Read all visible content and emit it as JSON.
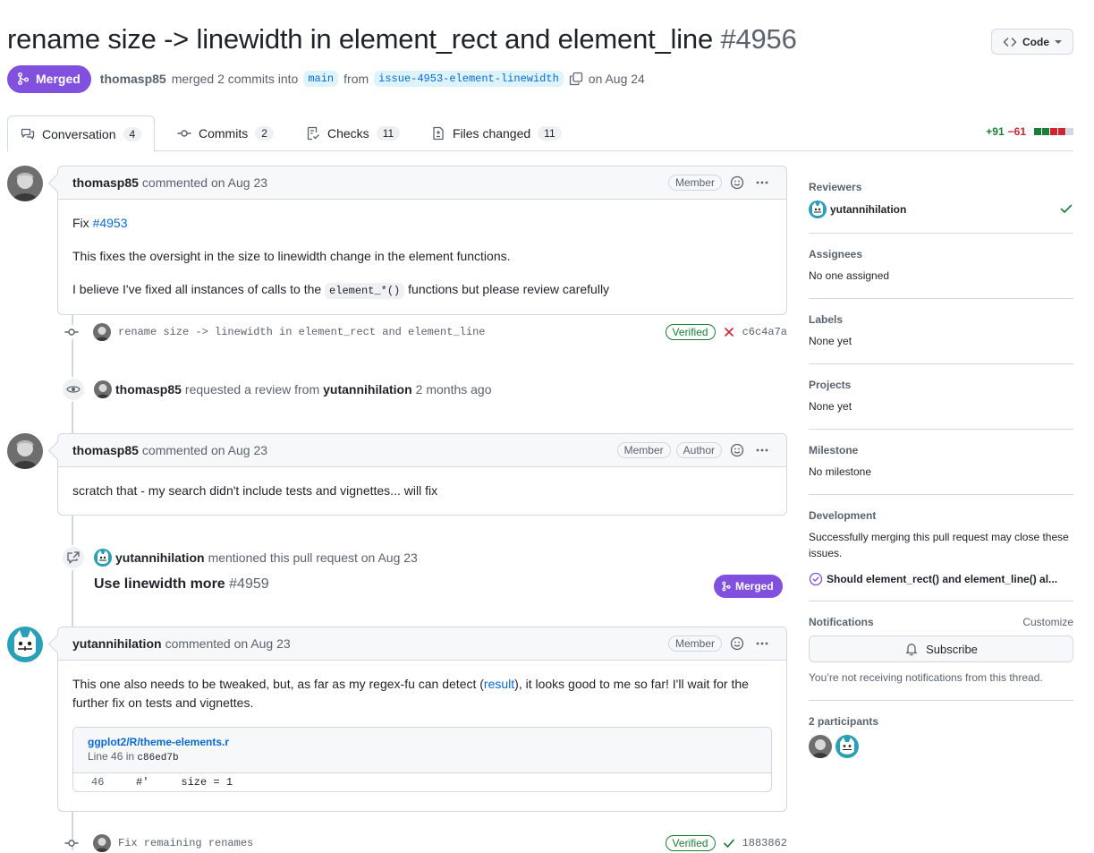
{
  "header": {
    "title": "rename size -> linewidth in element_rect and element_line",
    "number": "#4956",
    "code_button": "Code",
    "state": "Merged",
    "author": "thomasp85",
    "merge_text": "merged 2 commits into",
    "base_branch": "main",
    "from_text": "from",
    "head_branch": "issue-4953-element-linewidth",
    "date_text": "on Aug 24"
  },
  "tabs": [
    {
      "label": "Conversation",
      "count": "4"
    },
    {
      "label": "Commits",
      "count": "2"
    },
    {
      "label": "Checks",
      "count": "11"
    },
    {
      "label": "Files changed",
      "count": "11"
    }
  ],
  "diffstat": {
    "additions": "+91",
    "deletions": "−61"
  },
  "comments": {
    "c1": {
      "author": "thomasp85",
      "action": "commented on Aug 23",
      "roles": [
        "Member"
      ],
      "fix_prefix": "Fix",
      "fix_link": "#4953",
      "para2": "This fixes the oversight in the size to linewidth change in the element functions.",
      "para3_pre": "I believe I've fixed all instances of calls to the",
      "para3_code": "element_*()",
      "para3_post": "functions but please review carefully"
    },
    "c2": {
      "author": "thomasp85",
      "action": "commented on Aug 23",
      "roles": [
        "Member",
        "Author"
      ],
      "body": "scratch that - my search didn't include tests and vignettes... will fix"
    },
    "c3": {
      "author": "yutannihilation",
      "action": "commented on Aug 23",
      "roles": [
        "Member"
      ],
      "body_pre": "This one also needs to be tweaked, but, as far as my regex-fu can detect (",
      "body_link": "result",
      "body_post": "), it looks good to me so far! I'll wait for the further fix on tests and vignettes.",
      "snippet_path": "ggplot2/R/theme-elements.r",
      "snippet_loc_pre": "Line 46 in",
      "snippet_sha": "c86ed7b",
      "snippet_line_no": "46",
      "snippet_code": "#'     size = 1"
    }
  },
  "events": {
    "commit1": {
      "message": "rename size -> linewidth in element_rect and element_line",
      "verified": "Verified",
      "sha": "c6c4a7a",
      "status": "fail"
    },
    "review_request": {
      "actor": "thomasp85",
      "text": "requested a review from",
      "reviewer": "yutannihilation",
      "time": "2 months ago"
    },
    "mention": {
      "actor": "yutannihilation",
      "text": "mentioned this pull request on Aug 23",
      "ref_title": "Use linewidth more",
      "ref_number": "#4959",
      "ref_state": "Merged"
    },
    "commit2": {
      "message": "Fix remaining renames",
      "verified": "Verified",
      "sha": "1883862",
      "status": "success"
    }
  },
  "sidebar": {
    "reviewers": {
      "label": "Reviewers",
      "name": "yutannihilation"
    },
    "assignees": {
      "label": "Assignees",
      "value": "No one assigned"
    },
    "labels": {
      "label": "Labels",
      "value": "None yet"
    },
    "projects": {
      "label": "Projects",
      "value": "None yet"
    },
    "milestone": {
      "label": "Milestone",
      "value": "No milestone"
    },
    "development": {
      "label": "Development",
      "value": "Successfully merging this pull request may close these issues.",
      "issue": "Should element_rect() and element_line() al..."
    },
    "notifications": {
      "label": "Notifications",
      "customize": "Customize",
      "button": "Subscribe",
      "note": "You’re not receiving notifications from this thread."
    },
    "participants": {
      "label": "2 participants"
    }
  },
  "colors": {
    "merged": "#8250df",
    "link": "#0969da",
    "success": "#1a7f37",
    "danger": "#d1242f",
    "border": "#d1d9e0"
  }
}
